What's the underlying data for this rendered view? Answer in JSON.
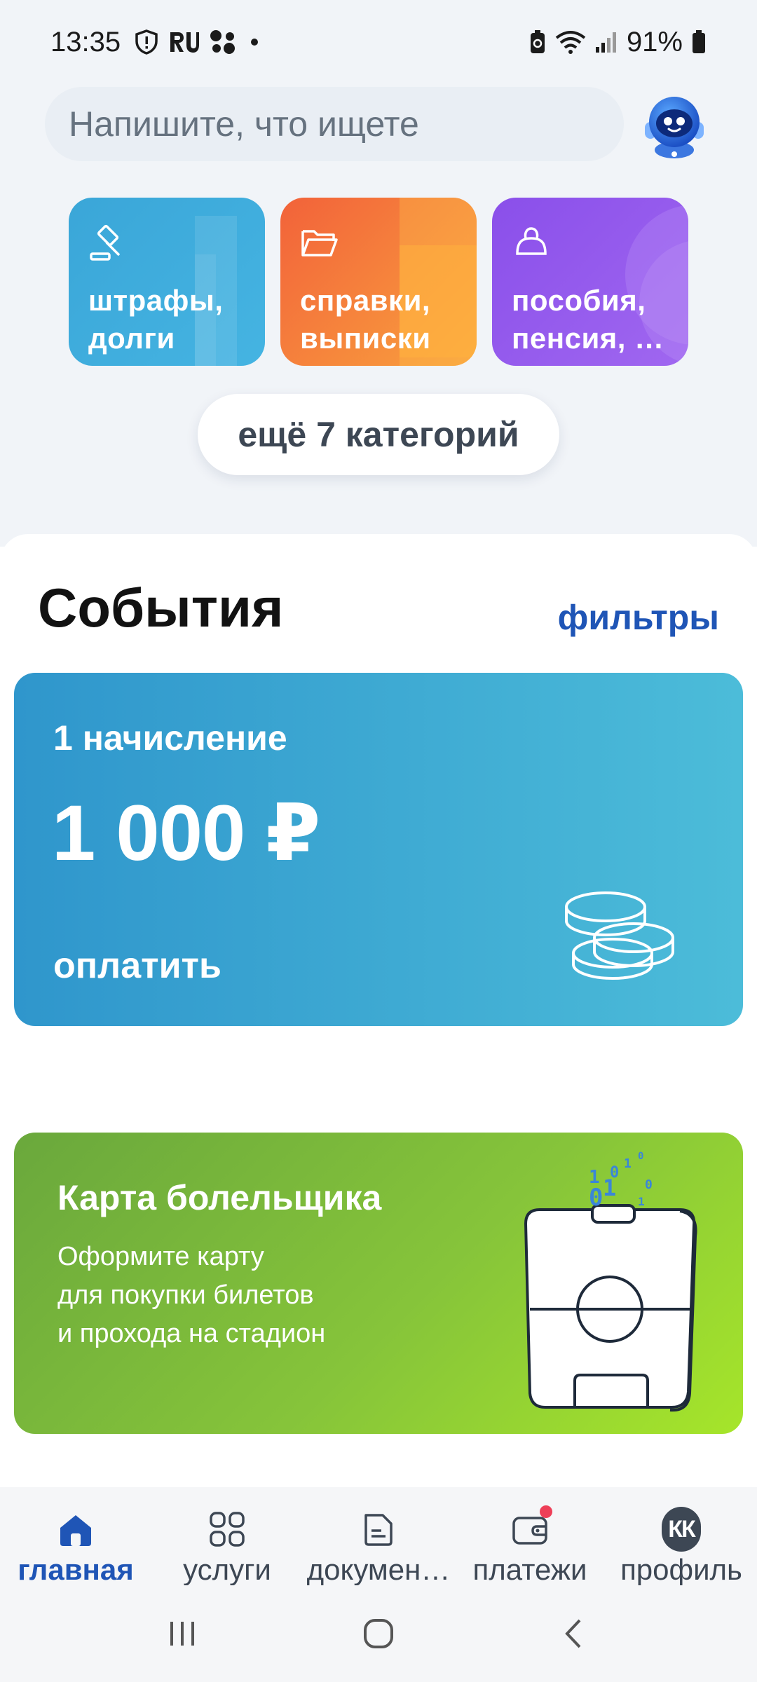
{
  "status_bar": {
    "time": "13:35",
    "battery": "91%",
    "left_icons": [
      "shield-icon",
      "ru-icon",
      "dots-icon",
      "dot-icon"
    ],
    "right_icons": [
      "battery-saver-icon",
      "wifi-icon",
      "signal-icon",
      "battery-icon"
    ]
  },
  "search": {
    "placeholder": "Напишите, что ищете",
    "assistant_icon": "robot-assistant-icon"
  },
  "categories": [
    {
      "label": "штрафы, долги",
      "line1": "штрафы,",
      "line2": "долги",
      "icon": "gavel-icon",
      "color": "#3aa6d8"
    },
    {
      "label": "справки, выписки",
      "line1": "справки,",
      "line2": "выписки",
      "icon": "folder-icon",
      "color": "#f2623a"
    },
    {
      "label": "пособия, пенсия, …",
      "line1": "пособия,",
      "line2": "пенсия, …",
      "icon": "purse-icon",
      "color": "#8a4fea"
    }
  ],
  "more_categories": "ещё 7 категорий",
  "events": {
    "title": "События",
    "filters": "фильтры",
    "charge_card": {
      "count": "1 начисление",
      "amount": "1 000 ₽",
      "action": "оплатить",
      "icon": "coins-icon"
    },
    "fan_card": {
      "title": "Карта болельщика",
      "line1": "Оформите карту",
      "line2": "для покупки билетов",
      "line3": "и прохода на стадион",
      "icon": "fan-card-illustration"
    }
  },
  "bottom_nav": {
    "items": [
      {
        "label": "главная",
        "icon": "home-icon",
        "active": true
      },
      {
        "label": "услуги",
        "icon": "grid-icon",
        "active": false
      },
      {
        "label": "докумен…",
        "icon": "document-icon",
        "active": false
      },
      {
        "label": "платежи",
        "icon": "wallet-icon",
        "active": false,
        "badge": true
      },
      {
        "label": "профиль",
        "icon": "avatar",
        "active": false,
        "initials": "КК"
      }
    ]
  },
  "colors": {
    "accent_blue": "#1f55b6",
    "background": "#f1f4f8",
    "badge_red": "#ee3f58"
  }
}
